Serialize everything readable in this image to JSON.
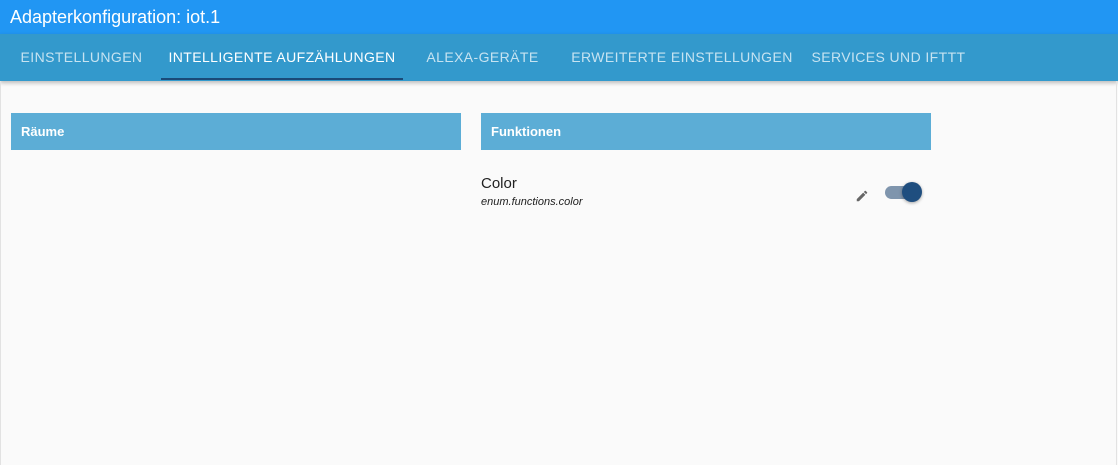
{
  "window": {
    "title": "Adapterkonfiguration: iot.1"
  },
  "tabs": [
    {
      "label": "EINSTELLUNGEN",
      "active": false
    },
    {
      "label": "INTELLIGENTE AUFZÄHLUNGEN",
      "active": true
    },
    {
      "label": "ALEXA-GERÄTE",
      "active": false
    },
    {
      "label": "ERWEITERTE EINSTELLUNGEN",
      "active": false
    },
    {
      "label": "SERVICES UND IFTTT",
      "active": false
    }
  ],
  "panels": {
    "rooms": {
      "header": "Räume",
      "items": []
    },
    "functions": {
      "header": "Funktionen",
      "items": [
        {
          "title": "Color",
          "id": "enum.functions.color",
          "enabled": true,
          "edit_icon": "pencil-icon"
        }
      ]
    }
  },
  "colors": {
    "titlebar": "#2196f3",
    "tabbar": "#3399cc",
    "tab_indicator": "#1a4a78",
    "panel_header": "#5cadd6",
    "toggle_on": "#1f4e7f"
  }
}
